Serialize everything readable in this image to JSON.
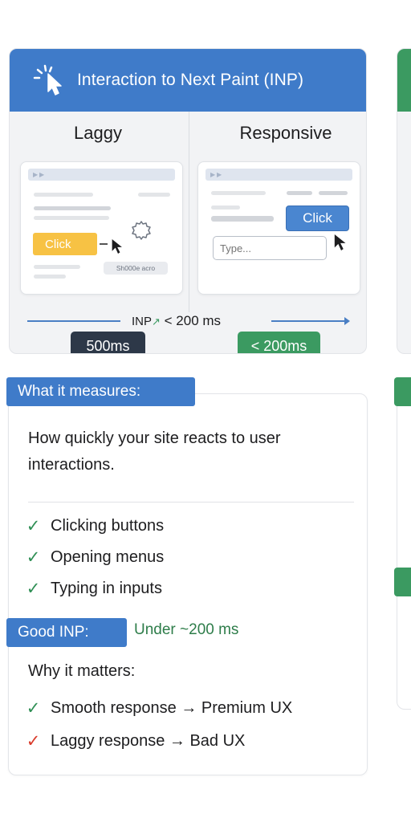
{
  "inp_card": {
    "title": "Interaction to Next Paint (INP)",
    "left": {
      "title": "Laggy",
      "button": "Click",
      "loading_text": "Sh000e acro",
      "badge": "500ms"
    },
    "right": {
      "title": "Responsive",
      "button": "Click",
      "input_placeholder": "Type...",
      "badge": "< 200ms"
    },
    "scale": {
      "abbr": "INP",
      "spark": "↗",
      "value": "< 200 ms"
    }
  },
  "info": {
    "measures_label": "What it measures:",
    "description": "How quickly your site reacts to user interactions.",
    "examples": [
      "Clicking buttons",
      "Opening menus",
      "Typing in inputs"
    ],
    "good_label": "Good INP:",
    "good_value": "Under ~200 ms",
    "why_title": "Why it matters:",
    "why_items": [
      {
        "mark": "✓",
        "text": "Smooth response → Premium UX"
      },
      {
        "mark": "✓",
        "text": "Laggy response → Bad UX"
      }
    ],
    "check_mark": "✓"
  },
  "colors": {
    "primary_blue": "#3f7bc9",
    "good_green": "#3b9a61",
    "slow_dark": "#2d3848",
    "warn_yellow": "#f7c244",
    "bad_red": "#d93b2b"
  },
  "icons": {
    "header": "cursor-click-icon",
    "loading": "gear-icon",
    "pointer": "mouse-pointer-icon",
    "check": "check-icon"
  }
}
